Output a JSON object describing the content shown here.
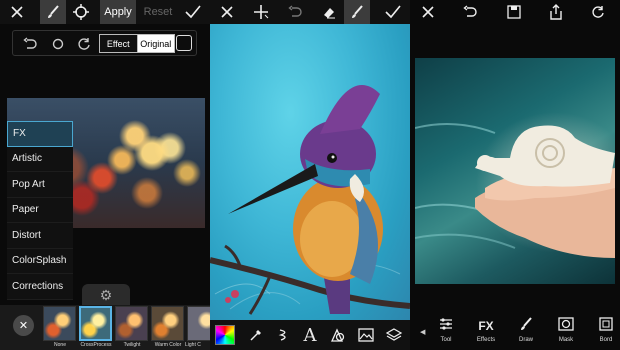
{
  "panel1": {
    "top_bar": {
      "close_icon": "close-icon",
      "brush_icon": "brush-icon",
      "target_icon": "target-icon",
      "apply_label": "Apply",
      "reset_label": "Reset",
      "confirm_icon": "checkmark-icon"
    },
    "tool_row": {
      "undo_icon": "undo-icon",
      "circle_icon": "circle-icon",
      "refresh_icon": "refresh-icon",
      "effect_label": "Effect",
      "original_label": "Original",
      "square_icon": "square-icon"
    },
    "fx_menu": [
      "FX",
      "Artistic",
      "Pop Art",
      "Paper",
      "Distort",
      "ColorSplash",
      "Corrections"
    ],
    "fx_selected": "FX",
    "gear_icon": "gear-icon",
    "close_filter_icon": "close-icon",
    "filters": [
      "None",
      "CrossProcess",
      "Twilight",
      "Warm Color",
      "Light C"
    ],
    "filter_selected": "CrossProcess"
  },
  "panel2": {
    "top_bar": {
      "close_icon": "close-icon",
      "add_icon": "plus-icon",
      "undo_icon": "undo-icon",
      "eraser_icon": "eraser-icon",
      "brush_icon": "brush-icon",
      "confirm_icon": "checkmark-icon"
    },
    "bottom_bar": [
      "color-swatch",
      "eyedropper-icon",
      "brush-stroke-icon",
      "text-icon",
      "shapes-icon",
      "image-icon",
      "layers-icon"
    ],
    "text_glyph": "A"
  },
  "panel3": {
    "top_bar": [
      "close-icon",
      "undo-icon",
      "save-icon",
      "share-icon",
      "refresh-icon"
    ],
    "toolbar": [
      {
        "label": "Tool",
        "icon": "sliders-icon"
      },
      {
        "label": "Effects",
        "icon": "fx-icon"
      },
      {
        "label": "Draw",
        "icon": "brush-icon"
      },
      {
        "label": "Mask",
        "icon": "mask-icon"
      },
      {
        "label": "Bord",
        "icon": "border-icon"
      }
    ],
    "fx_glyph": "FX"
  }
}
